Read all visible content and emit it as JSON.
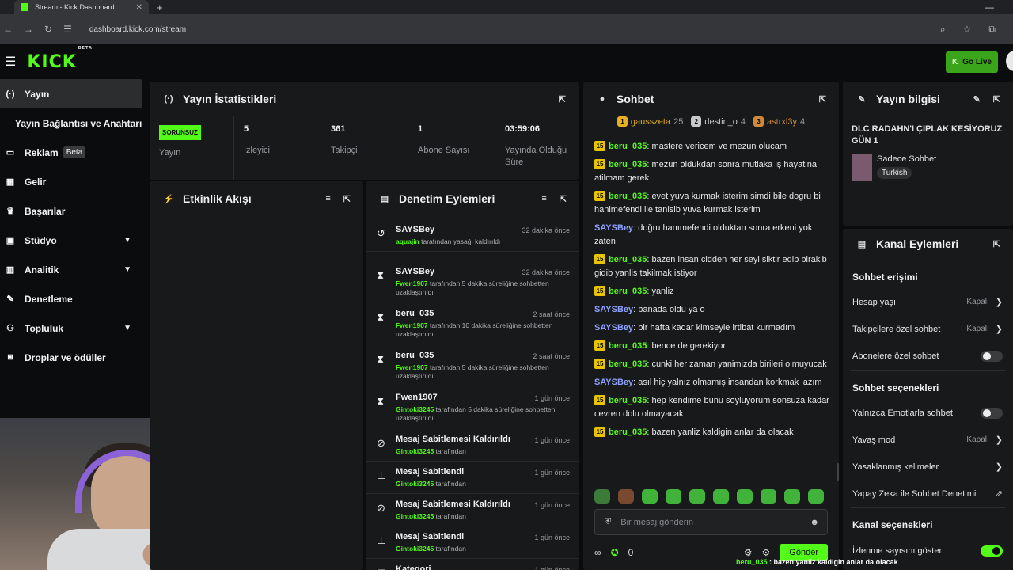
{
  "browser": {
    "tab_title": "Stream - Kick Dashboard",
    "url": "dashboard.kick.com/stream"
  },
  "header": {
    "logo": "KICK",
    "logo_badge": "BETA",
    "go_live": "Go Live"
  },
  "sidebar": {
    "items": [
      {
        "label": "Yayın",
        "icon": "broadcast-icon"
      },
      {
        "label": "Yayın Bağlantısı ve Anahtarı",
        "icon": ""
      },
      {
        "label": "Reklam",
        "icon": "ad-icon",
        "badge": "Beta"
      },
      {
        "label": "Gelir",
        "icon": "revenue-icon"
      },
      {
        "label": "Başarılar",
        "icon": "trophy-icon"
      },
      {
        "label": "Stüdyo",
        "icon": "studio-icon"
      },
      {
        "label": "Analitik",
        "icon": "analytics-icon"
      },
      {
        "label": "Denetleme",
        "icon": "wrench-icon"
      },
      {
        "label": "Topluluk",
        "icon": "community-icon"
      },
      {
        "label": "Droplar ve ödüller",
        "icon": "gift-icon"
      }
    ]
  },
  "stats": {
    "title": "Yayın İstatistikleri",
    "status_badge": "SORUNSUZ",
    "status_label": "Yayın",
    "items": [
      {
        "value": "5",
        "label": "İzleyici"
      },
      {
        "value": "361",
        "label": "Takipçi"
      },
      {
        "value": "1",
        "label": "Abone Sayısı"
      },
      {
        "value": "03:59:06",
        "label": "Yayında Olduğu Süre"
      }
    ]
  },
  "activity": {
    "title": "Etkinlik Akışı"
  },
  "moderation": {
    "title": "Denetim Eylemleri",
    "items": [
      {
        "icon": "unban-icon",
        "name": "SAYSBey",
        "time": "32 dakika önce",
        "actor": "aquajin",
        "desc": " tarafından yasağı kaldırıldı"
      },
      {
        "icon": "timeout-icon",
        "name": "SAYSBey",
        "time": "32 dakika önce",
        "actor": "Fwen1907",
        "desc": " tarafından 5 dakika süreliğine sohbetten uzaklaştırıldı"
      },
      {
        "icon": "timeout-icon",
        "name": "beru_035",
        "time": "2 saat önce",
        "actor": "Fwen1907",
        "desc": " tarafından 10 dakika süreliğine sohbetten uzaklaştırıldı"
      },
      {
        "icon": "timeout-icon",
        "name": "beru_035",
        "time": "2 saat önce",
        "actor": "Fwen1907",
        "desc": " tarafından 5 dakika süreliğine sohbetten uzaklaştırıldı"
      },
      {
        "icon": "timeout-icon",
        "name": "Fwen1907",
        "time": "1 gün önce",
        "actor": "Gintoki3245",
        "desc": " tarafından 5 dakika süreliğine sohbetten uzaklaştırıldı"
      },
      {
        "icon": "unpin-icon",
        "name": "Mesaj Sabitlemesi Kaldırıldı",
        "time": "1 gün önce",
        "actor": "Gintoki3245",
        "desc": " tarafından"
      },
      {
        "icon": "pin-icon",
        "name": "Mesaj Sabitlendi",
        "time": "1 gün önce",
        "actor": "Gintoki3245",
        "desc": " tarafından"
      },
      {
        "icon": "unpin-icon",
        "name": "Mesaj Sabitlemesi Kaldırıldı",
        "time": "1 gün önce",
        "actor": "Gintoki3245",
        "desc": " tarafından"
      },
      {
        "icon": "pin-icon",
        "name": "Mesaj Sabitlendi",
        "time": "1 gün önce",
        "actor": "Gintoki3245",
        "desc": " tarafından"
      },
      {
        "icon": "category-icon",
        "name": "Kategori",
        "time": "1 gün önce",
        "actor": "",
        "desc": ""
      }
    ]
  },
  "chat": {
    "title": "Sohbet",
    "top": [
      {
        "rank": "1",
        "name": "gausszeta",
        "count": "25",
        "color": "#e8b020"
      },
      {
        "rank": "2",
        "name": "destin_o",
        "count": "4",
        "color": "#c8c8c8"
      },
      {
        "rank": "3",
        "name": "astrxl3y",
        "count": "4",
        "color": "#d08a3a"
      }
    ],
    "messages": [
      {
        "sub": "15",
        "user": "beru_035",
        "color": "green",
        "text": "mastere vericem ve mezun olucam"
      },
      {
        "sub": "15",
        "user": "beru_035",
        "color": "green",
        "text": "mezun oldukdan sonra mutlaka iş hayatina atilmam gerek"
      },
      {
        "sub": "15",
        "user": "beru_035",
        "color": "green",
        "text": "evet yuva kurmak isterim simdi bile dogru bi hanimefendi ile tanisib yuva kurmak isterim"
      },
      {
        "sub": "",
        "user": "SAYSBey",
        "color": "blue",
        "text": "doğru hanımefendi olduktan sonra erkeni yok zaten"
      },
      {
        "sub": "15",
        "user": "beru_035",
        "color": "green",
        "text": "bazen insan cidden her seyi siktir edib birakib gidib yanlis takilmak istiyor"
      },
      {
        "sub": "15",
        "user": "beru_035",
        "color": "green",
        "text": "yanliz"
      },
      {
        "sub": "",
        "user": "SAYSBey",
        "color": "blue",
        "text": "banada oldu ya o"
      },
      {
        "sub": "",
        "user": "SAYSBey",
        "color": "blue",
        "text": "bir hafta kadar kimseyle irtibat kurmadım"
      },
      {
        "sub": "15",
        "user": "beru_035",
        "color": "green",
        "text": "bence de gerekiyor"
      },
      {
        "sub": "15",
        "user": "beru_035",
        "color": "green",
        "text": "cunki her zaman yanimizda birileri olmuyucak"
      },
      {
        "sub": "",
        "user": "SAYSBey",
        "color": "blue",
        "text": "asıl hiç yalnız olmamış insandan korkmak lazım"
      },
      {
        "sub": "15",
        "user": "beru_035",
        "color": "green",
        "text": "hep kendime bunu soyluyorum sonsuza kadar cevren dolu olmayacak"
      },
      {
        "sub": "15",
        "user": "beru_035",
        "color": "green",
        "text": "bazen yanliz kaldigin anlar da olacak"
      }
    ],
    "input_placeholder": "Bir mesaj gönderin",
    "points": "0",
    "send": "Gönder"
  },
  "stream_info": {
    "title": "Yayın bilgisi",
    "stream_title": "DLC RADAHN'I ÇIPLAK KESİYORUZ GÜN 1",
    "category": "Sadece Sohbet",
    "language": "Turkish"
  },
  "channel_actions": {
    "title": "Kanal Eylemleri",
    "section1": "Sohbet erişimi",
    "rows1": [
      {
        "label": "Hesap yaşı",
        "value": "Kapalı",
        "type": "arrow"
      },
      {
        "label": "Takipçilere özel sohbet",
        "value": "Kapalı",
        "type": "arrow"
      },
      {
        "label": "Abonelere özel sohbet",
        "value": "",
        "type": "toggle"
      }
    ],
    "section2": "Sohbet seçenekleri",
    "rows2": [
      {
        "label": "Yalnızca Emotlarla sohbet",
        "value": "",
        "type": "toggle"
      },
      {
        "label": "Yavaş mod",
        "value": "Kapalı",
        "type": "arrow"
      },
      {
        "label": "Yasaklanmış kelimeler",
        "value": "",
        "type": "arrow"
      },
      {
        "label": "Yapay Zeka ile Sohbet Denetimi",
        "value": "",
        "type": "external"
      }
    ],
    "section3": "Kanal seçenekleri",
    "rows3": [
      {
        "label": "İzlenme sayısını göster",
        "value": "",
        "type": "toggle-on"
      }
    ]
  },
  "overlay": {
    "user": "beru_035",
    "text": " : bazen yanliz kaldigin anlar da olacak"
  },
  "colors": {
    "accent": "#53fc18",
    "background": "#0b0c0d",
    "panel": "#17191a"
  }
}
